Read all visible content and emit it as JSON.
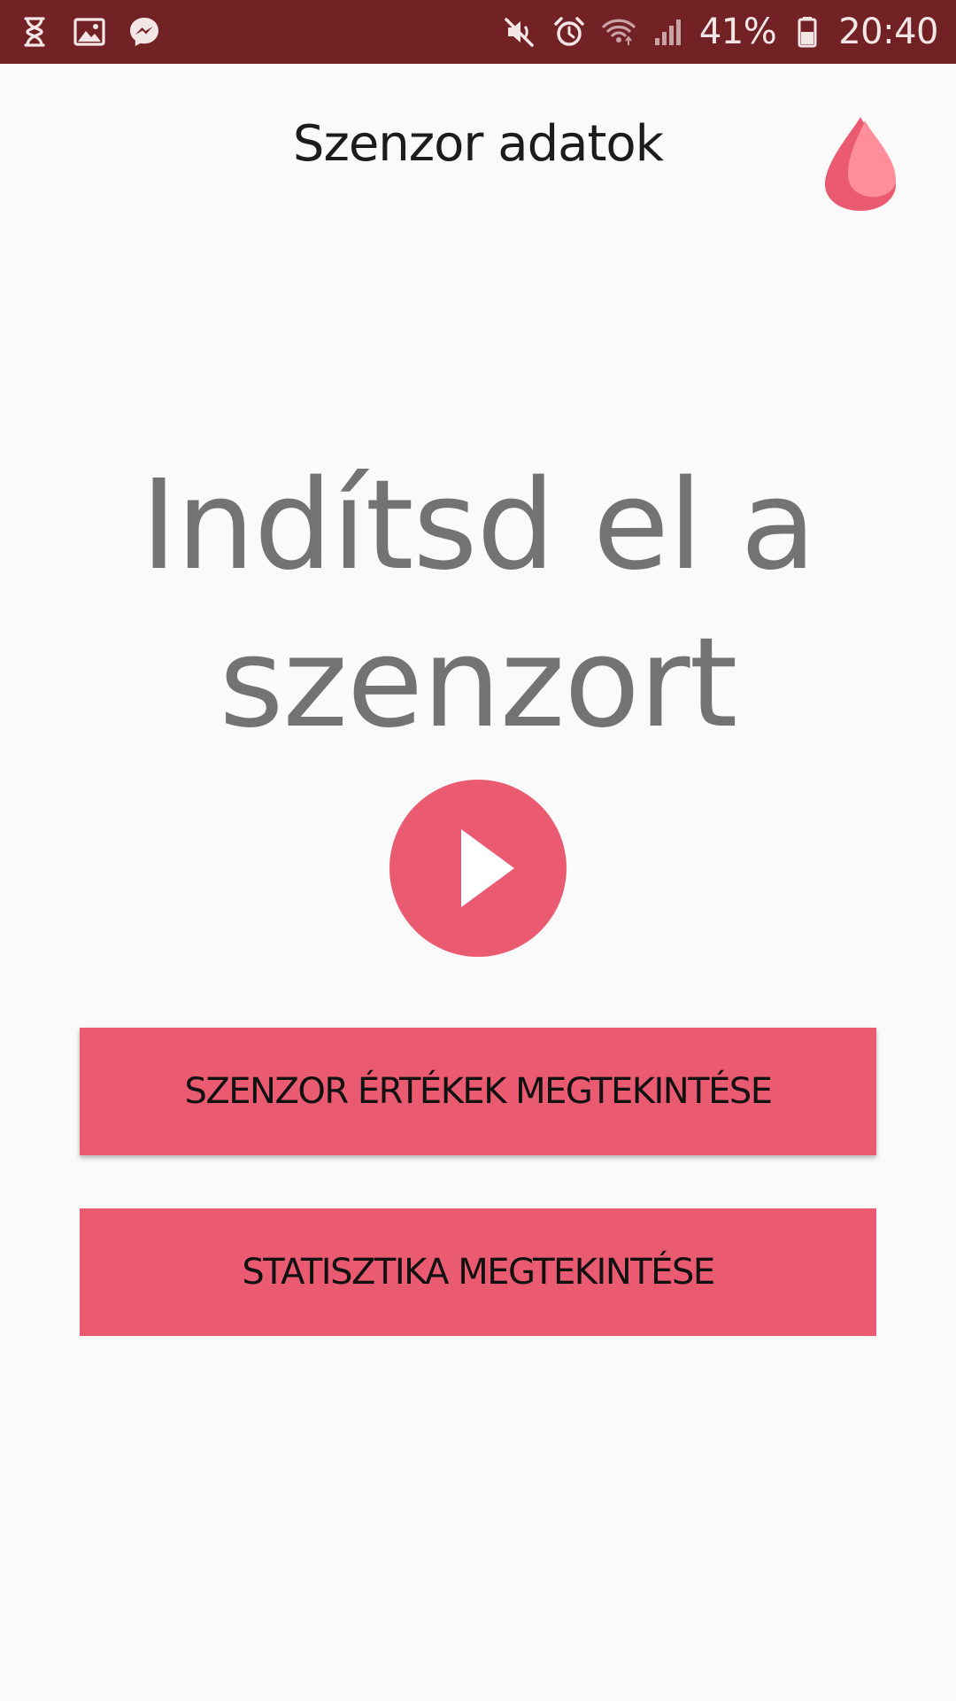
{
  "status_bar": {
    "battery_percent": "41%",
    "time": "20:40",
    "left_icons": [
      "hourglass-icon",
      "gallery-icon",
      "messenger-icon"
    ],
    "right_icons": [
      "mute-icon",
      "alarm-icon",
      "wifi-icon",
      "signal-icon",
      "battery-icon"
    ],
    "background_color": "#722124"
  },
  "header": {
    "title": "Szenzor adatok",
    "logo_icon": "blood-drop-icon"
  },
  "main": {
    "headline_line1": "Indítsd el a",
    "headline_line2": "szenzort",
    "play_icon": "play-icon"
  },
  "buttons": {
    "sensor_values": "SZENZOR ÉRTÉKEK MEGTEKINTÉSE",
    "statistics": "STATISZTIKA MEGTEKINTÉSE"
  },
  "colors": {
    "accent": "#ea5b71",
    "headline_text": "#737373",
    "drop_light": "#ff8d9a",
    "drop_dark": "#ea5b71"
  }
}
